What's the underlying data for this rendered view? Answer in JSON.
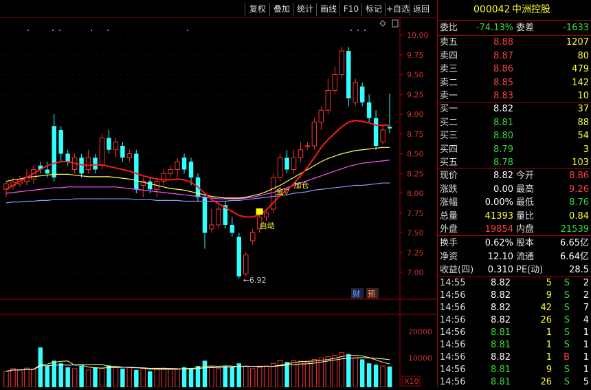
{
  "toolbar": {
    "buttons": [
      "复权",
      "叠加",
      "统计",
      "画线",
      "F10",
      "标记",
      "+自选",
      "返回"
    ]
  },
  "stock": {
    "code": "000042",
    "name": "中洲控股"
  },
  "weibi": {
    "label1": "委比",
    "v1": "-74.13%",
    "label2": "委差",
    "v2": "-1633"
  },
  "asks": [
    {
      "label": "卖五",
      "price": "8.88",
      "vol": "1207"
    },
    {
      "label": "卖四",
      "price": "8.87",
      "vol": "80"
    },
    {
      "label": "卖三",
      "price": "8.86",
      "vol": "479"
    },
    {
      "label": "卖二",
      "price": "8.85",
      "vol": "142"
    },
    {
      "label": "卖一",
      "price": "8.83",
      "vol": "10"
    }
  ],
  "bids": [
    {
      "label": "买一",
      "price": "8.82",
      "vol": "37"
    },
    {
      "label": "买二",
      "price": "8.81",
      "vol": "88"
    },
    {
      "label": "买三",
      "price": "8.80",
      "vol": "54"
    },
    {
      "label": "买四",
      "price": "8.79",
      "vol": "3"
    },
    {
      "label": "买五",
      "price": "8.78",
      "vol": "103"
    }
  ],
  "quote": [
    {
      "l1": "现价",
      "v1": "8.82",
      "l2": "今开",
      "v2": "8.86"
    },
    {
      "l1": "涨跌",
      "v1": "0.00",
      "l2": "最高",
      "v2": "9.26"
    },
    {
      "l1": "涨幅",
      "v1": "0.00%",
      "l2": "最低",
      "v2": "8.76"
    },
    {
      "l1": "总量",
      "v1": "41393",
      "l2": "量比",
      "v2": "0.84"
    },
    {
      "l1": "外盘",
      "v1": "19854",
      "l2": "内盘",
      "v2": "21539"
    }
  ],
  "finance": [
    {
      "l1": "换手",
      "v1": "0.62%",
      "l2": "股本",
      "v2": "6.65亿"
    },
    {
      "l1": "净资",
      "v1": "12.10",
      "l2": "流通",
      "v2": "6.64亿"
    },
    {
      "l1": "收益(四)",
      "v1": "0.310",
      "l2": "PE(动)",
      "v2": "28.5"
    }
  ],
  "ticks": [
    {
      "time": "14:55",
      "price": "8.82",
      "vol": "5",
      "side": "S",
      "n": "2"
    },
    {
      "time": "14:56",
      "price": "8.82",
      "vol": "9",
      "side": "S",
      "n": "2"
    },
    {
      "time": "14:56",
      "price": "8.82",
      "vol": "42",
      "side": "S",
      "n": "7"
    },
    {
      "time": "14:56",
      "price": "8.82",
      "vol": "26",
      "side": "S",
      "n": "4"
    },
    {
      "time": "14:56",
      "price": "8.81",
      "vol": "1",
      "side": "S",
      "n": "1"
    },
    {
      "time": "14:56",
      "price": "8.81",
      "vol": "1",
      "side": "S",
      "n": "1"
    },
    {
      "time": "14:56",
      "price": "8.82",
      "vol": "1",
      "side": "B",
      "n": "1"
    },
    {
      "time": "14:56",
      "price": "8.81",
      "vol": "9",
      "side": "S",
      "n": "1"
    },
    {
      "time": "14:56",
      "price": "8.81",
      "vol": "26",
      "side": "S",
      "n": "5"
    }
  ],
  "chart": {
    "price_ticks": [
      "10.00",
      "9.75",
      "9.50",
      "9.25",
      "9.00",
      "8.75",
      "8.50",
      "8.25",
      "8.00",
      "7.75",
      "7.50",
      "7.25",
      "7.00"
    ],
    "vol_ticks": [
      "20000",
      "10000"
    ],
    "vol_unit": "X10",
    "annotations": {
      "low": "6.92",
      "start": "启动",
      "gold": "金",
      "add": "加仓",
      "cai": "财",
      "yu": "预"
    }
  },
  "chart_data": {
    "type": "candlestick",
    "ylim": [
      6.9,
      10.1
    ],
    "candles": [
      [
        8.05,
        8.12,
        7.95,
        8.15
      ],
      [
        8.1,
        8.14,
        8.05,
        8.2
      ],
      [
        8.12,
        8.18,
        8.08,
        8.22
      ],
      [
        8.15,
        8.2,
        8.1,
        8.3
      ],
      [
        8.18,
        8.3,
        8.12,
        8.35
      ],
      [
        8.35,
        8.3,
        8.25,
        8.4
      ],
      [
        8.3,
        8.25,
        8.2,
        8.4
      ],
      [
        8.85,
        8.2,
        8.15,
        9.0
      ],
      [
        8.8,
        8.5,
        8.4,
        8.85
      ],
      [
        8.5,
        8.4,
        8.35,
        8.55
      ],
      [
        8.3,
        8.45,
        8.25,
        8.5
      ],
      [
        8.45,
        8.25,
        8.2,
        8.5
      ],
      [
        8.3,
        8.45,
        8.25,
        8.55
      ],
      [
        8.45,
        8.3,
        8.25,
        8.5
      ],
      [
        8.35,
        8.7,
        8.3,
        8.75
      ],
      [
        8.7,
        8.55,
        8.5,
        8.8
      ],
      [
        8.55,
        8.65,
        8.45,
        8.7
      ],
      [
        8.6,
        8.45,
        8.4,
        8.65
      ],
      [
        8.45,
        8.5,
        8.4,
        8.55
      ],
      [
        8.5,
        8.05,
        8.0,
        8.55
      ],
      [
        8.1,
        8.15,
        7.95,
        8.2
      ],
      [
        8.15,
        8.05,
        8.0,
        8.2
      ],
      [
        8.05,
        8.15,
        7.95,
        8.2
      ],
      [
        8.15,
        8.25,
        8.1,
        8.3
      ],
      [
        8.25,
        8.3,
        8.2,
        8.35
      ],
      [
        8.3,
        8.4,
        8.2,
        8.45
      ],
      [
        8.45,
        8.3,
        8.25,
        8.5
      ],
      [
        8.4,
        8.2,
        8.1,
        8.45
      ],
      [
        8.2,
        7.95,
        7.9,
        8.25
      ],
      [
        7.95,
        7.5,
        7.3,
        8.0
      ],
      [
        7.55,
        7.6,
        7.5,
        7.8
      ],
      [
        7.6,
        7.8,
        7.55,
        7.85
      ],
      [
        7.85,
        7.6,
        7.55,
        7.9
      ],
      [
        7.6,
        7.5,
        7.45,
        7.7
      ],
      [
        7.45,
        6.95,
        6.92,
        7.5
      ],
      [
        6.98,
        7.22,
        6.95,
        7.25
      ],
      [
        7.4,
        7.5,
        7.35,
        7.55
      ],
      [
        7.55,
        7.7,
        7.5,
        7.75
      ],
      [
        7.7,
        7.75,
        7.65,
        7.8
      ],
      [
        7.8,
        8.2,
        7.75,
        8.25
      ],
      [
        8.2,
        8.45,
        8.15,
        8.5
      ],
      [
        8.45,
        8.3,
        8.25,
        8.55
      ],
      [
        8.3,
        8.45,
        8.25,
        8.55
      ],
      [
        8.45,
        8.55,
        8.4,
        8.65
      ],
      [
        8.6,
        8.6,
        8.55,
        8.65
      ],
      [
        8.6,
        8.9,
        8.55,
        8.95
      ],
      [
        8.9,
        9.05,
        8.8,
        9.1
      ],
      [
        9.05,
        9.3,
        9.0,
        9.45
      ],
      [
        9.3,
        9.5,
        9.25,
        9.6
      ],
      [
        9.5,
        9.8,
        9.45,
        9.85
      ],
      [
        9.8,
        9.2,
        9.1,
        9.85
      ],
      [
        9.15,
        9.4,
        9.1,
        9.45
      ],
      [
        9.35,
        9.15,
        9.1,
        9.4
      ],
      [
        9.15,
        8.95,
        8.9,
        9.25
      ],
      [
        8.95,
        8.6,
        8.55,
        9.05
      ],
      [
        8.65,
        8.8,
        8.62,
        8.85
      ],
      [
        8.84,
        8.82,
        8.76,
        9.26
      ]
    ],
    "ma_red": [
      8.05,
      8.1,
      8.15,
      8.2,
      8.25,
      8.3,
      8.35,
      8.38,
      8.4,
      8.4,
      8.38,
      8.36,
      8.35,
      8.36,
      8.36,
      8.34,
      8.32,
      8.3,
      8.28,
      8.25,
      8.22,
      8.2,
      8.18,
      8.17,
      8.17,
      8.18,
      8.17,
      8.14,
      8.08,
      8.0,
      7.92,
      7.87,
      7.82,
      7.77,
      7.72,
      7.7,
      7.7,
      7.73,
      7.79,
      7.88,
      7.97,
      8.04,
      8.12,
      8.22,
      8.33,
      8.45,
      8.58,
      8.68,
      8.76,
      8.84,
      8.9,
      8.92,
      8.91,
      8.89,
      8.86,
      8.86,
      8.86
    ],
    "ma_yellow": [
      8.15,
      8.17,
      8.18,
      8.2,
      8.21,
      8.22,
      8.23,
      8.24,
      8.24,
      8.24,
      8.23,
      8.22,
      8.21,
      8.21,
      8.21,
      8.21,
      8.2,
      8.19,
      8.18,
      8.16,
      8.14,
      8.12,
      8.1,
      8.08,
      8.06,
      8.05,
      8.04,
      8.02,
      8.0,
      7.98,
      7.96,
      7.95,
      7.94,
      7.94,
      7.94,
      7.95,
      7.97,
      7.99,
      8.02,
      8.06,
      8.1,
      8.15,
      8.2,
      8.25,
      8.3,
      8.35,
      8.4,
      8.44,
      8.47,
      8.5,
      8.52,
      8.54,
      8.55,
      8.56,
      8.57,
      8.58,
      8.58
    ],
    "ma_magenta": [
      8.0,
      8.01,
      8.02,
      8.03,
      8.04,
      8.05,
      8.06,
      8.07,
      8.07,
      8.08,
      8.08,
      8.08,
      8.08,
      8.08,
      8.08,
      8.08,
      8.08,
      8.07,
      8.06,
      8.05,
      8.04,
      8.03,
      8.02,
      8.01,
      8.0,
      7.99,
      7.98,
      7.97,
      7.96,
      7.95,
      7.94,
      7.93,
      7.93,
      7.93,
      7.93,
      7.94,
      7.95,
      7.97,
      7.99,
      8.01,
      8.04,
      8.07,
      8.1,
      8.13,
      8.16,
      8.19,
      8.22,
      8.25,
      8.28,
      8.31,
      8.34,
      8.36,
      8.38,
      8.39,
      8.4,
      8.41,
      8.42
    ],
    "ma_blue": [
      7.88,
      7.89,
      7.89,
      7.9,
      7.9,
      7.91,
      7.91,
      7.92,
      7.92,
      7.92,
      7.93,
      7.93,
      7.93,
      7.93,
      7.93,
      7.93,
      7.93,
      7.93,
      7.93,
      7.92,
      7.92,
      7.92,
      7.91,
      7.91,
      7.91,
      7.91,
      7.9,
      7.9,
      7.9,
      7.9,
      7.9,
      7.9,
      7.9,
      7.91,
      7.91,
      7.92,
      7.93,
      7.94,
      7.95,
      7.96,
      7.97,
      7.98,
      8.0,
      8.01,
      8.02,
      8.04,
      8.05,
      8.06,
      8.07,
      8.08,
      8.09,
      8.1,
      8.1,
      8.11,
      8.12,
      8.13,
      8.13
    ],
    "volumes": [
      5000,
      6000,
      5500,
      6200,
      5800,
      14000,
      7000,
      9000,
      8000,
      6500,
      6000,
      7000,
      5500,
      6500,
      6000,
      7200,
      6800,
      6000,
      6500,
      5500,
      6000,
      5000,
      5800,
      6200,
      5800,
      6000,
      6500,
      6000,
      7000,
      9000,
      6500,
      6000,
      6800,
      6500,
      8000,
      7000,
      6000,
      6500,
      7000,
      8000,
      9000,
      8500,
      9000,
      8800,
      8500,
      9500,
      10000,
      10500,
      11000,
      12000,
      11500,
      10000,
      9500,
      8000,
      7500,
      7000,
      6800
    ],
    "vol_ylim": [
      0,
      26000
    ]
  }
}
